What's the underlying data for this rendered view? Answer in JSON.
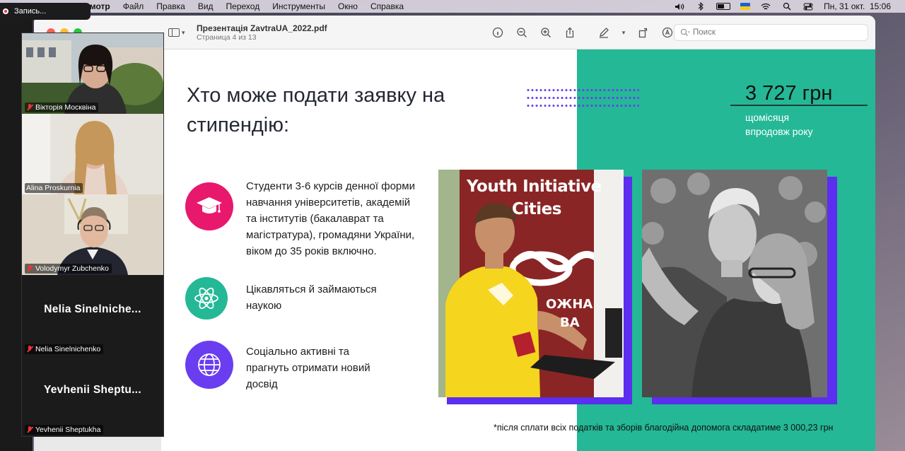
{
  "menubar": {
    "app_name": "Просмотр",
    "items": [
      "Файл",
      "Правка",
      "Вид",
      "Переход",
      "Инструменты",
      "Окно",
      "Справка"
    ],
    "datetime": "Пн, 31 окт.  15:06"
  },
  "zoom": {
    "recording_label": "Запись...",
    "participants": [
      {
        "name": "Вікторія Москвіна",
        "video": true
      },
      {
        "name": "Alina Proskurnia",
        "video": true
      },
      {
        "name": "Volodymyr Zubchenko",
        "video": true
      },
      {
        "name": "Nelia Sinelnichenko",
        "display_name": "Nelia  Sinelniche...",
        "video": false
      },
      {
        "name": "Yevhenii Sheptukha",
        "display_name": "Yevhenii  Sheptu...",
        "video": false
      }
    ]
  },
  "preview": {
    "doc_title": "Презентація ZavtraUA_2022.pdf",
    "page_status": "Страница 4 из 13",
    "search_placeholder": "Поиск",
    "toolbar_icons": [
      "info-icon",
      "zoom-out-icon",
      "zoom-in-icon",
      "share-icon",
      "markup-icon",
      "rotate-icon",
      "annotate-icon"
    ]
  },
  "slide": {
    "title": "Хто може подати заявку на стипендію:",
    "amount": "3 727 грн",
    "amount_sub_1": "щомісяця",
    "amount_sub_2": "впродовж року",
    "bullets": [
      {
        "icon": "graduation-cap-icon",
        "color": "#e8186d",
        "text": "Студенти 3-6 курсів денної форми навчання університетів, академій та інститутів (бакалаврат та магістратура), громадяни України, віком до 35 років включно."
      },
      {
        "icon": "atom-icon",
        "color": "#24b896",
        "text": "Цікавляться й займаються наукою"
      },
      {
        "icon": "globe-icon",
        "color": "#6a3df0",
        "text": "Соціально активні та прагнуть отримати новий досвід"
      }
    ],
    "photo1_banner_line1": "Youth Initiative",
    "photo1_banner_line2": "Cities",
    "photo1_banner_line3": "ОЖНА",
    "photo1_banner_line4": "ВА",
    "footnote": "*після сплати всіх податків та зборів благодійна допомога складатиме 3 000,23 грн"
  },
  "colors": {
    "teal": "#24b896",
    "purple": "#5b2ef0",
    "pink": "#e8186d"
  }
}
